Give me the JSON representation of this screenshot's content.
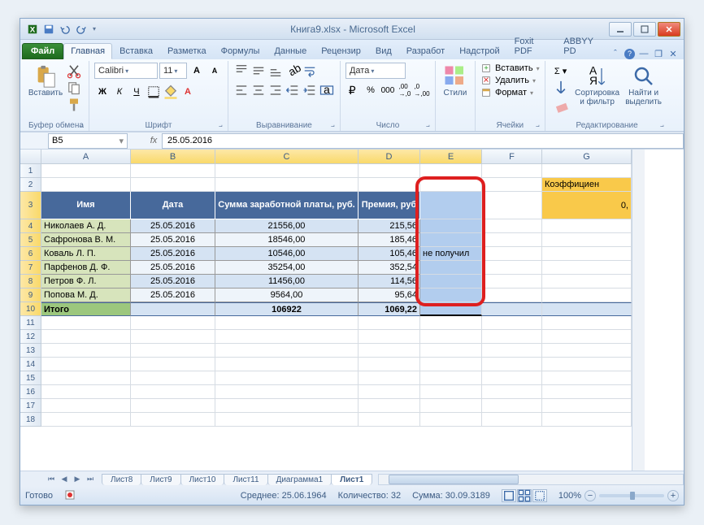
{
  "window": {
    "title": "Книга9.xlsx - Microsoft Excel"
  },
  "tabs": {
    "file": "Файл",
    "items": [
      "Главная",
      "Вставка",
      "Разметка",
      "Формулы",
      "Данные",
      "Рецензир",
      "Вид",
      "Разработ",
      "Надстрой",
      "Foxit PDF",
      "ABBYY PD"
    ],
    "active": 0
  },
  "ribbon": {
    "clipboard": {
      "paste": "Вставить",
      "label": "Буфер обмена"
    },
    "font": {
      "name": "Calibri",
      "size": "11",
      "label": "Шрифт"
    },
    "align": {
      "label": "Выравнивание"
    },
    "number": {
      "format": "Дата",
      "label": "Число"
    },
    "styles": {
      "styles": "Стили"
    },
    "cells": {
      "insert": "Вставить",
      "delete": "Удалить",
      "format": "Формат",
      "label": "Ячейки"
    },
    "editing": {
      "sort": "Сортировка\nи фильтр",
      "find": "Найти и\nвыделить",
      "label": "Редактирование"
    }
  },
  "namebox": "B5",
  "formula": "25.05.2016",
  "columns": [
    "A",
    "B",
    "C",
    "D",
    "E",
    "F",
    "G"
  ],
  "rownums": [
    1,
    2,
    3,
    4,
    5,
    6,
    7,
    8,
    9,
    10,
    11,
    12,
    13,
    14,
    15,
    16,
    17,
    18
  ],
  "table": {
    "headers": [
      "Имя",
      "Дата",
      "Сумма заработной платы, руб.",
      "Премия, руб"
    ],
    "rows": [
      {
        "name": "Николаев А. Д.",
        "date": "25.05.2016",
        "sum": "21556,00",
        "bonus": "215,56"
      },
      {
        "name": "Сафронова В. М.",
        "date": "25.05.2016",
        "sum": "18546,00",
        "bonus": "185,46"
      },
      {
        "name": "Коваль Л. П.",
        "date": "25.05.2016",
        "sum": "10546,00",
        "bonus": "105,46"
      },
      {
        "name": "Парфенов Д. Ф.",
        "date": "25.05.2016",
        "sum": "35254,00",
        "bonus": "352,54"
      },
      {
        "name": "Петров Ф. Л.",
        "date": "25.05.2016",
        "sum": "11456,00",
        "bonus": "114,56"
      },
      {
        "name": "Попова М. Д.",
        "date": "25.05.2016",
        "sum": "9564,00",
        "bonus": "95,64"
      }
    ],
    "total": {
      "name": "Итого",
      "sum": "106922",
      "bonus": "1069,22"
    },
    "e_overflow": "не получил",
    "g2": "Коэффициен",
    "g3": "0,"
  },
  "sheets": {
    "items": [
      "Лист8",
      "Лист9",
      "Лист10",
      "Лист11",
      "Диаграмма1",
      "Лист1"
    ],
    "active": 5
  },
  "status": {
    "ready": "Готово",
    "avg_lbl": "Среднее:",
    "avg": "25.06.1964",
    "count_lbl": "Количество:",
    "count": "32",
    "sum_lbl": "Сумма:",
    "sum": "30.09.3189",
    "zoom": "100%"
  }
}
